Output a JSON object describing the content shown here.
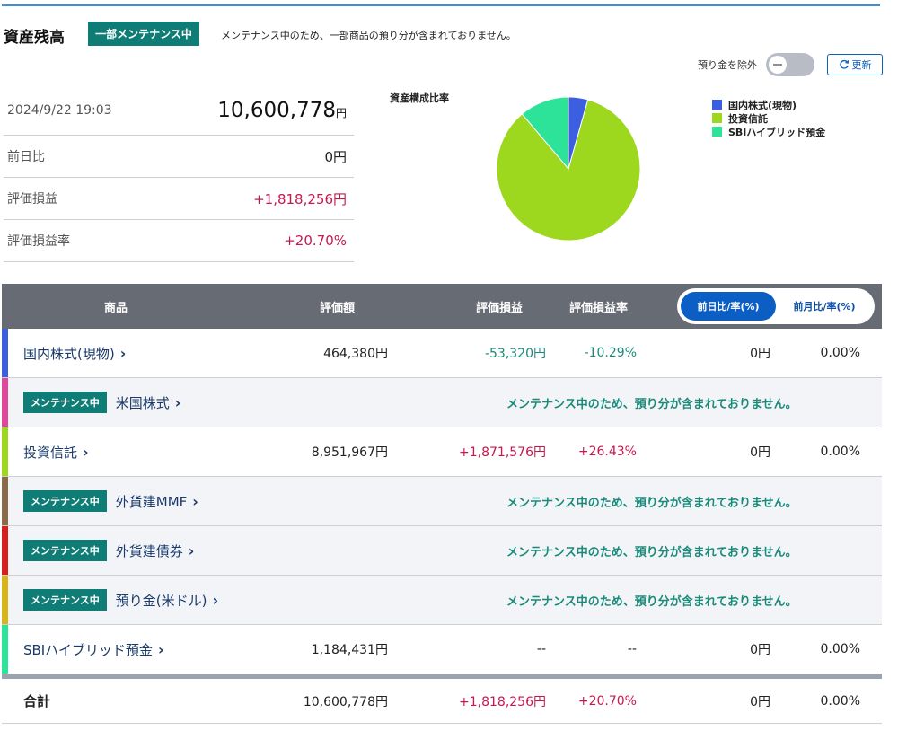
{
  "header": {
    "title": "資産残高",
    "maintenance_badge": "一部メンテナンス中",
    "maintenance_message": "メンテナンス中のため、一部商品の預り分が含まれておりません。",
    "toggle_label": "預り金を除外",
    "refresh_label": "更新"
  },
  "summary": {
    "timestamp": "2024/9/22 19:03",
    "total_value": "10,600,778",
    "total_unit": "円",
    "day_change_label": "前日比",
    "day_change_value": "0円",
    "pl_label": "評価損益",
    "pl_value": "+1,818,256円",
    "pl_rate_label": "評価損益率",
    "pl_rate_value": "+20.70%"
  },
  "chart_data": {
    "type": "pie",
    "title": "資産構成比率",
    "categories": [
      "国内株式(現物)",
      "投資信託",
      "SBIハイブリッド預金"
    ],
    "values": [
      464380,
      8951967,
      1184431
    ],
    "colors": [
      "#3b5fe0",
      "#9dd81f",
      "#2de39a"
    ]
  },
  "table": {
    "headers": {
      "product": "商品",
      "value": "評価額",
      "pl": "評価損益",
      "pl_rate": "評価損益率"
    },
    "tabs": {
      "active": "前日比/率(%)",
      "inactive": "前月比/率(%)"
    },
    "maint_badge": "メンテナンス中",
    "maint_message": "メンテナンス中のため、預り分が含まれておりません。",
    "rows": [
      {
        "name": "国内株式(現物)",
        "color": "#3b5fe0",
        "maintenance": false,
        "value": "464,380円",
        "pl": "-53,320円",
        "pl_rate": "-10.29%",
        "day": "0円",
        "day_rate": "0.00%"
      },
      {
        "name": "米国株式",
        "color": "#e0489a",
        "maintenance": true
      },
      {
        "name": "投資信託",
        "color": "#9dd81f",
        "maintenance": false,
        "value": "8,951,967円",
        "pl": "+1,871,576円",
        "pl_rate": "+26.43%",
        "day": "0円",
        "day_rate": "0.00%"
      },
      {
        "name": "外貨建MMF",
        "color": "#8b6a4a",
        "maintenance": true
      },
      {
        "name": "外貨建債券",
        "color": "#d61f1f",
        "maintenance": true
      },
      {
        "name": "預り金(米ドル)",
        "color": "#d6b41a",
        "maintenance": true
      },
      {
        "name": "SBIハイブリッド預金",
        "color": "#2de39a",
        "maintenance": false,
        "value": "1,184,431円",
        "pl": "--",
        "pl_rate": "--",
        "day": "0円",
        "day_rate": "0.00%"
      }
    ],
    "total": {
      "name": "合計",
      "value": "10,600,778円",
      "pl": "+1,818,256円",
      "pl_rate": "+20.70%",
      "day": "0円",
      "day_rate": "0.00%"
    }
  }
}
